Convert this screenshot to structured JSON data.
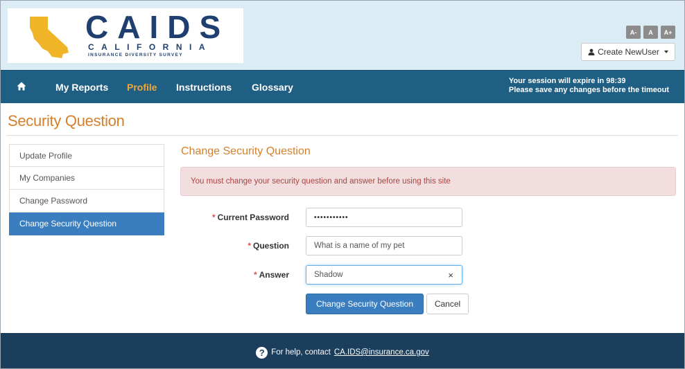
{
  "header": {
    "logo": {
      "title": "CAIDS",
      "state": "CALIFORNIA",
      "subtitle": "INSURANCE DIVERSITY SURVEY"
    },
    "font_size_buttons": [
      "A-",
      "A",
      "A+"
    ],
    "user_menu": {
      "label": "Create NewUser",
      "icon": "user-icon"
    }
  },
  "nav": {
    "home_icon": "home-icon",
    "items": [
      {
        "label": "My Reports",
        "active": false
      },
      {
        "label": "Profile",
        "active": true
      },
      {
        "label": "Instructions",
        "active": false
      },
      {
        "label": "Glossary",
        "active": false
      }
    ],
    "session_line1": "Your session will expire in 98:39",
    "session_line2": "Please save any changes before the timeout"
  },
  "page": {
    "title": "Security Question"
  },
  "sidebar": {
    "items": [
      {
        "label": "Update Profile",
        "active": false
      },
      {
        "label": "My Companies",
        "active": false
      },
      {
        "label": "Change Password",
        "active": false
      },
      {
        "label": "Change Security Question",
        "active": true
      }
    ]
  },
  "main": {
    "section_title": "Change Security Question",
    "alert": "You must change your security question and answer before using this site",
    "form": {
      "current_password": {
        "label": "Current Password",
        "value": "•••••••••••"
      },
      "question": {
        "label": "Question",
        "value": "What is a name of my pet"
      },
      "answer": {
        "label": "Answer",
        "value": "Shadow",
        "clear_icon": "×"
      },
      "required_marker": "*"
    },
    "buttons": {
      "submit": "Change Security Question",
      "cancel": "Cancel"
    }
  },
  "footer": {
    "help_icon": "?",
    "text": "For help, contact",
    "email": "CA.IDS@insurance.ca.gov"
  },
  "colors": {
    "header_bg": "#dbecf4",
    "nav_bg": "#1f5f84",
    "accent_orange": "#d4802b",
    "primary_blue": "#3a7ebf",
    "footer_bg": "#1b3e5c",
    "alert_bg": "#f2dede",
    "alert_text": "#a94442"
  }
}
